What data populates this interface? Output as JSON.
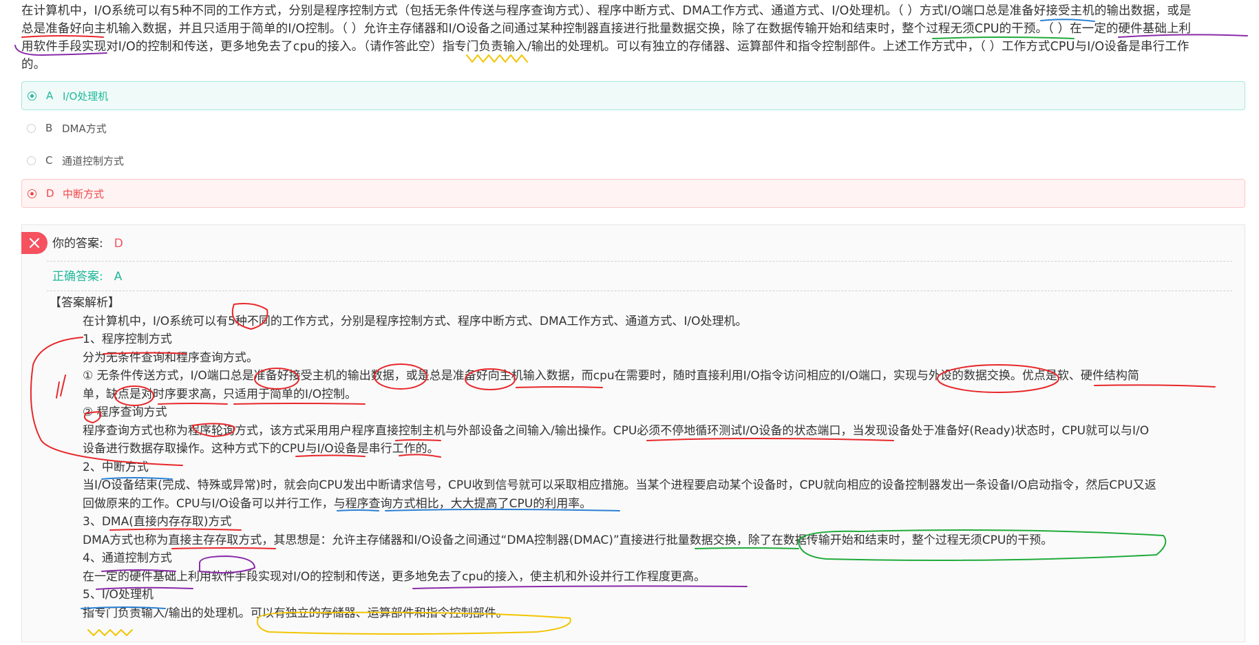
{
  "question": {
    "line1": "在计算机中，I/O系统可以有5种不同的工作方式，分别是程序控制方式（包括无条件传送与程序查询方式）、程序中断方式、DMA工作方式、通道方式、I/O处理机。（ ）方式I/O端口总是准备好接受主机的输出数据，或是",
    "line2": "总是准备好向主机输入数据，并且只适用于简单的I/O控制。（ ）允许主存储器和I/O设备之间通过某种控制器直接进行批量数据交换，除了在数据传输开始和结束时，整个过程无须CPU的干预。（ ）在一定的硬件基础上利",
    "line3": "用软件手段实现对I/O的控制和传送，更多地免去了cpu的接入。（请作答此空）指专门负责输入/输出的处理机。可以有独立的存储器、运算部件和指令控制部件。上述工作方式中，（ ）工作方式CPU与I/O设备是串行工作",
    "line4": "的。"
  },
  "options": [
    {
      "letter": "A",
      "text": "I/O处理机",
      "state": "correct"
    },
    {
      "letter": "B",
      "text": "DMA方式",
      "state": "plain"
    },
    {
      "letter": "C",
      "text": "通道控制方式",
      "state": "plain"
    },
    {
      "letter": "D",
      "text": "中断方式",
      "state": "wrong"
    }
  ],
  "result": {
    "your_answer_label": "你的答案:",
    "your_answer": "D",
    "correct_answer_label": "正确答案:",
    "correct_answer": "A",
    "close_icon": "close-icon"
  },
  "explanation": {
    "heading": "【答案解析】",
    "lines": [
      "在计算机中，I/O系统可以有5种不同的工作方式，分别是程序控制方式、程序中断方式、DMA工作方式、通道方式、I/O处理机。",
      "1、程序控制方式",
      "分为无条件查询和程序查询方式。",
      "① 无条件传送方式，I/O端口总是准备好接受主机的输出数据，或是总是准备好向主机输入数据，而cpu在需要时，随时直接利用I/O指令访问相应的I/O端口，实现与外设的数据交换。优点是软、硬件结构简",
      "单，缺点是对时序要求高，只适用于简单的I/O控制。",
      "② 程序查询方式",
      "程序查询方式也称为程序轮询方式，该方式采用用户程序直接控制主机与外部设备之间输入/输出操作。CPU必须不停地循环测试I/O设备的状态端口，当发现设备处于准备好(Ready)状态时，CPU就可以与I/O",
      "设备进行数据存取操作。这种方式下的CPU与I/O设备是串行工作的。",
      "2、中断方式",
      "当I/O设备结束(完成、特殊或异常)时，就会向CPU发出中断请求信号，CPU收到信号就可以采取相应措施。当某个进程要启动某个设备时，CPU就向相应的设备控制器发出一条设备I/O启动指令，然后CPU又返",
      "回做原来的工作。CPU与I/O设备可以并行工作，与程序查询方式相比，大大提高了CPU的利用率。",
      "3、DMA(直接内存存取)方式",
      "DMA方式也称为直接主存存取方式，其思想是：允许主存储器和I/O设备之间通过“DMA控制器(DMAC)”直接进行批量数据交换，除了在数据传输开始和结束时，整个过程无须CPU的干预。",
      "4、通道控制方式",
      "在一定的硬件基础上利用软件手段实现对I/O的控制和传送，更多地免去了cpu的接入，使主机和外设并行工作程度更高。",
      "5、I/O处理机",
      "指专门负责输入/输出的处理机。可以有独立的存储器、运算部件和指令控制部件。"
    ]
  },
  "colors": {
    "correct": "#1fb89a",
    "wrong": "#f04848",
    "ink_red": "#e8272a",
    "ink_blue": "#2a7fd4",
    "ink_green": "#1faa3a",
    "ink_purple": "#8a2aa8",
    "ink_yellow": "#f2c400"
  }
}
